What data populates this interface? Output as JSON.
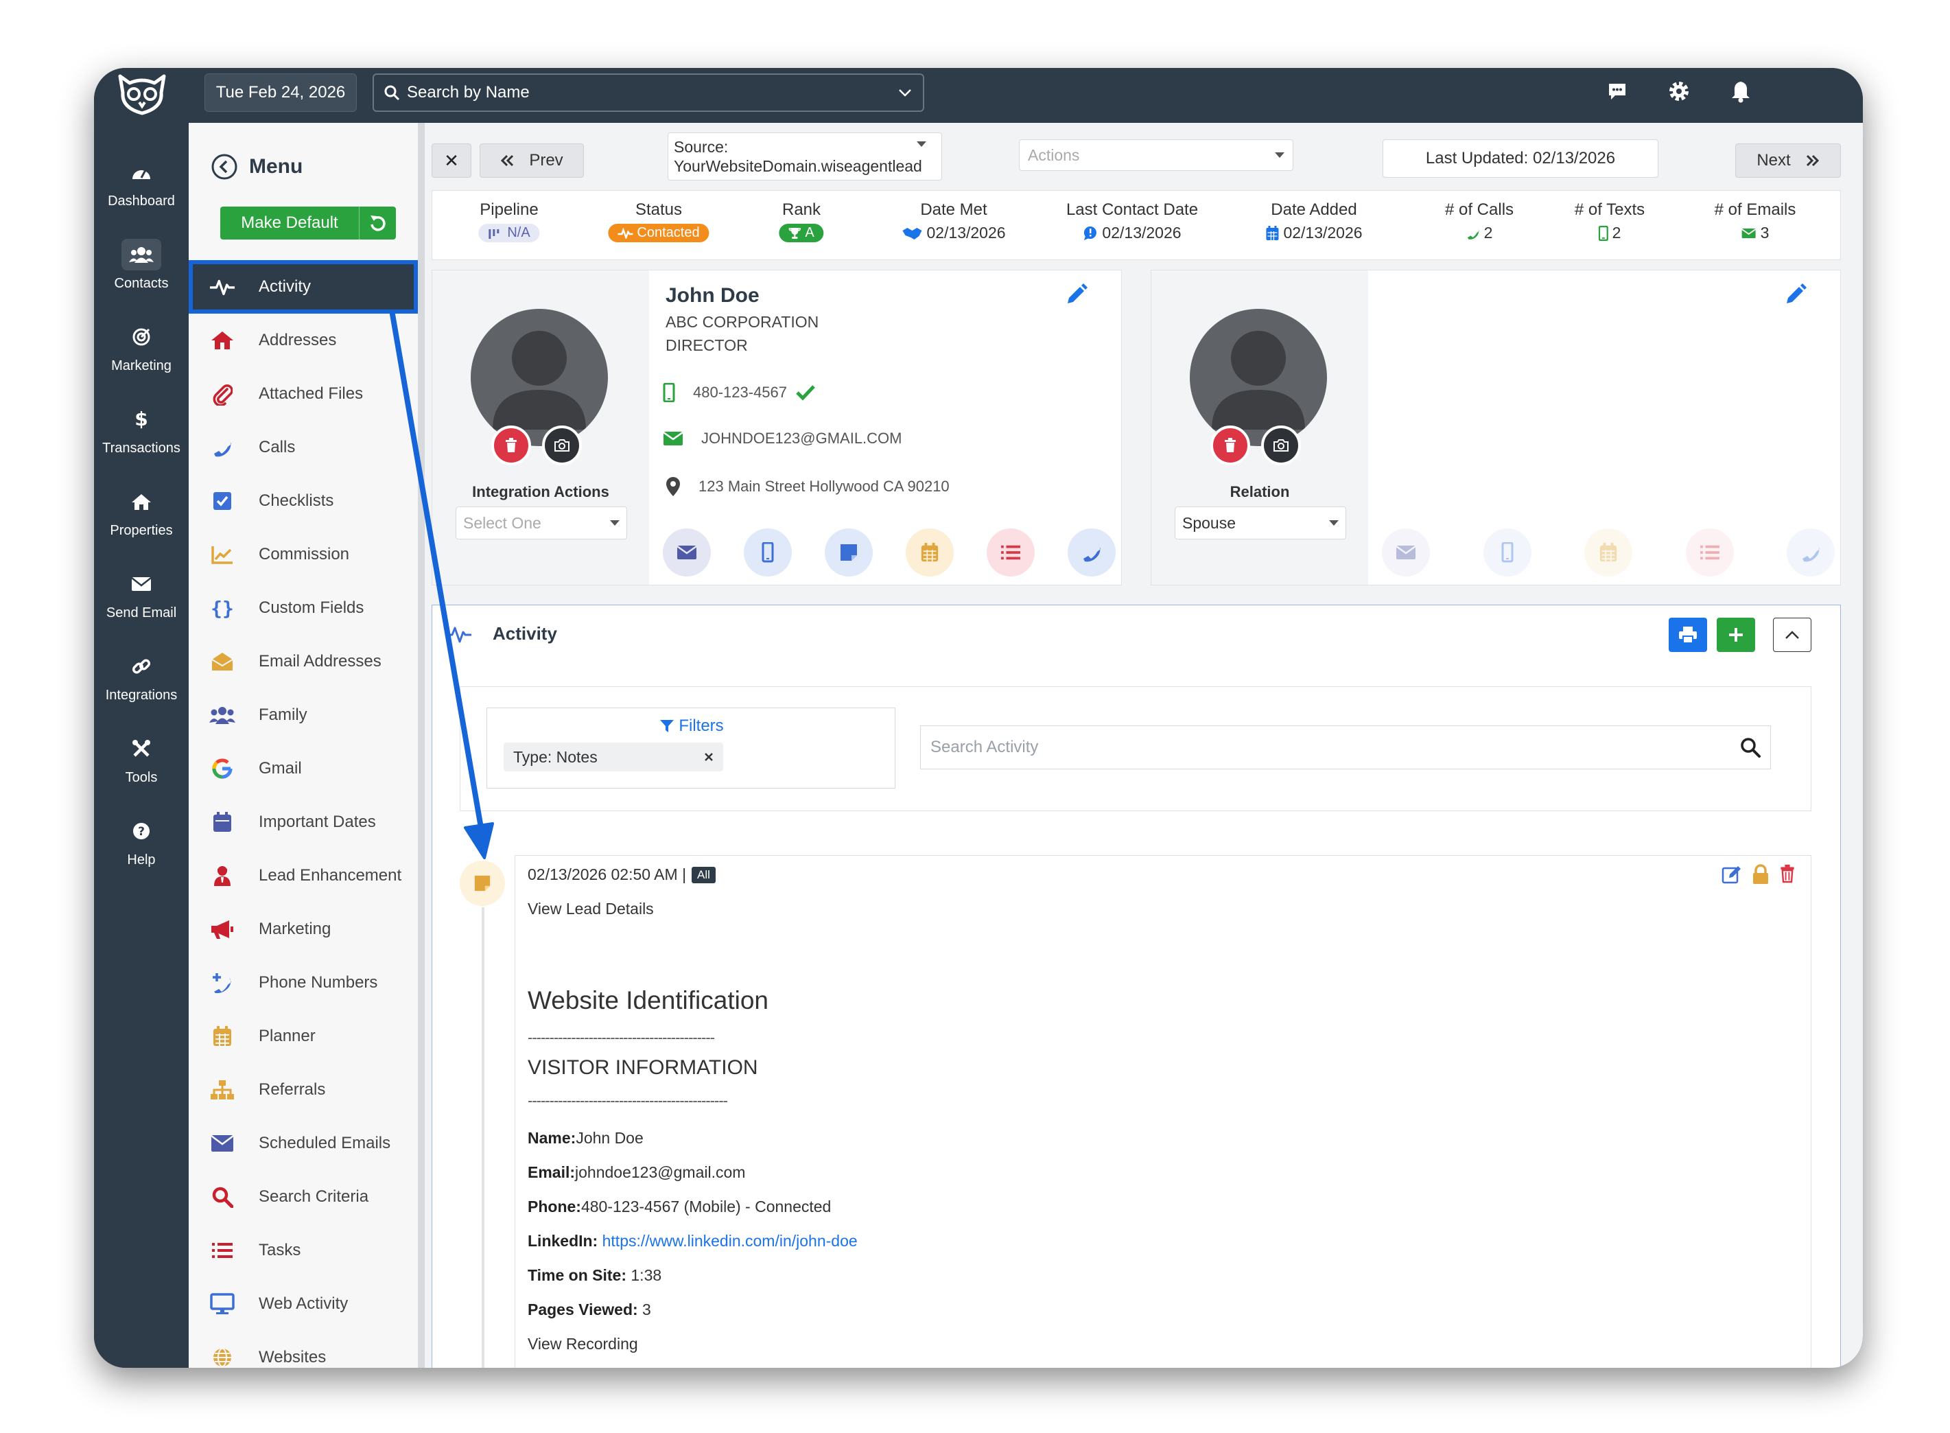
{
  "topbar": {
    "date": "Tue Feb 24, 2026",
    "search_placeholder": "Search by Name"
  },
  "leftnav": [
    {
      "label": "Dashboard",
      "icon": "dashboard-icon"
    },
    {
      "label": "Contacts",
      "icon": "contacts-icon",
      "active": true
    },
    {
      "label": "Marketing",
      "icon": "target-icon"
    },
    {
      "label": "Transactions",
      "icon": "dollar-icon"
    },
    {
      "label": "Properties",
      "icon": "home-icon"
    },
    {
      "label": "Send Email",
      "icon": "envelope-icon"
    },
    {
      "label": "Integrations",
      "icon": "link-icon"
    },
    {
      "label": "Tools",
      "icon": "tools-icon"
    },
    {
      "label": "Help",
      "icon": "help-icon"
    }
  ],
  "menu": {
    "title": "Menu",
    "make_default": "Make Default",
    "items": [
      {
        "label": "Activity",
        "color": "#ffffff"
      },
      {
        "label": "Addresses",
        "color": "#c8202f"
      },
      {
        "label": "Attached Files",
        "color": "#c8202f"
      },
      {
        "label": "Calls",
        "color": "#3b6fd6"
      },
      {
        "label": "Checklists",
        "color": "#3b6fd6"
      },
      {
        "label": "Commission",
        "color": "#e0a63c"
      },
      {
        "label": "Custom Fields",
        "color": "#3b6fd6"
      },
      {
        "label": "Email Addresses",
        "color": "#e0a63c"
      },
      {
        "label": "Family",
        "color": "#4d5aa8"
      },
      {
        "label": "Gmail",
        "color": "#ea4335"
      },
      {
        "label": "Important Dates",
        "color": "#4d5aa8"
      },
      {
        "label": "Lead Enhancement",
        "color": "#c8202f"
      },
      {
        "label": "Marketing",
        "color": "#c8202f"
      },
      {
        "label": "Phone Numbers",
        "color": "#3b6fd6"
      },
      {
        "label": "Planner",
        "color": "#e0a63c"
      },
      {
        "label": "Referrals",
        "color": "#e0a63c"
      },
      {
        "label": "Scheduled Emails",
        "color": "#4d5aa8"
      },
      {
        "label": "Search Criteria",
        "color": "#c8202f"
      },
      {
        "label": "Tasks",
        "color": "#c8202f"
      },
      {
        "label": "Web Activity",
        "color": "#3b6fd6"
      },
      {
        "label": "Websites",
        "color": "#e0a63c"
      }
    ]
  },
  "toolbar": {
    "close": "✕",
    "prev": "Prev",
    "source_label": "Source:",
    "source_value": "YourWebsiteDomain.wiseagentlead",
    "actions_placeholder": "Actions",
    "last_updated": "Last Updated: 02/13/2026",
    "next": "Next"
  },
  "stats": {
    "pipeline": {
      "label": "Pipeline",
      "value": "N/A"
    },
    "status": {
      "label": "Status",
      "value": "Contacted"
    },
    "rank": {
      "label": "Rank",
      "value": "A"
    },
    "date_met": {
      "label": "Date Met",
      "value": "02/13/2026"
    },
    "last_contact": {
      "label": "Last Contact Date",
      "value": "02/13/2026"
    },
    "date_added": {
      "label": "Date Added",
      "value": "02/13/2026"
    },
    "calls": {
      "label": "# of Calls",
      "value": "2"
    },
    "texts": {
      "label": "# of Texts",
      "value": "2"
    },
    "emails": {
      "label": "# of Emails",
      "value": "3"
    }
  },
  "contact": {
    "name": "John Doe",
    "company": "ABC CORPORATION",
    "title": "DIRECTOR",
    "phone": "480-123-4567",
    "email": "JOHNDOE123@GMAIL.COM",
    "address": "123 Main Street Hollywood CA 90210",
    "integration_label": "Integration Actions",
    "integration_placeholder": "Select One"
  },
  "relation": {
    "label": "Relation",
    "value": "Spouse"
  },
  "activity": {
    "title": "Activity",
    "filters_label": "Filters",
    "filter_chip": "Type: Notes",
    "search_placeholder": "Search Activity",
    "entry": {
      "datetime": "02/13/2026 02:50 AM |",
      "badge": "All",
      "view_lead": "View Lead Details",
      "heading": "Website Identification",
      "divider1": "-------------------------------------------",
      "subheading": "VISITOR INFORMATION",
      "divider2": "----------------------------------------------",
      "name_label": "Name:",
      "name_value": "John Doe",
      "email_label": "Email:",
      "email_value": "johndoe123@gmail.com",
      "phone_label": "Phone:",
      "phone_value": "480-123-4567 (Mobile) - Connected",
      "linkedin_label": "LinkedIn:",
      "linkedin_value": "https://www.linkedin.com/in/john-doe",
      "time_label": "Time on Site:",
      "time_value": "1:38",
      "pages_label": "Pages Viewed:",
      "pages_value": "3",
      "view_recording": "View Recording"
    }
  },
  "colors": {
    "sidebar": "#2e3b49",
    "accent_blue": "#1565d8",
    "green": "#2aa33e",
    "orange": "#f28c1b",
    "red": "#dc3545"
  }
}
